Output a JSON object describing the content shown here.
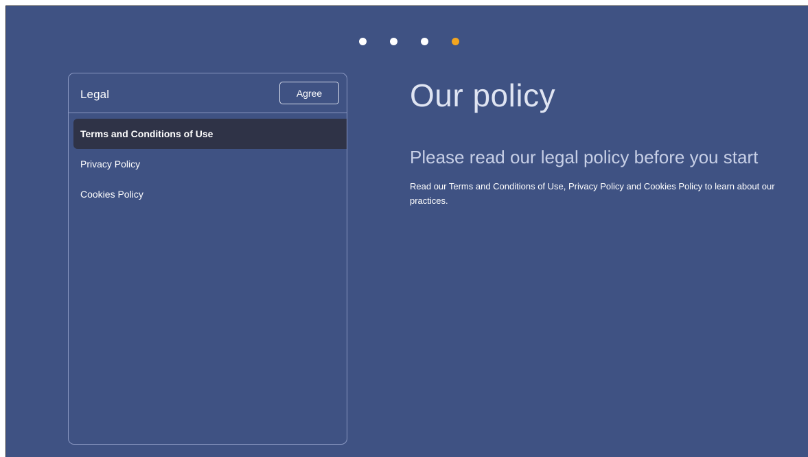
{
  "pager": {
    "dots": [
      {
        "color": "#ffffff",
        "active": false
      },
      {
        "color": "#ffffff",
        "active": false
      },
      {
        "color": "#ffffff",
        "active": false
      },
      {
        "color": "#f3a51f",
        "active": true
      }
    ]
  },
  "legal_panel": {
    "title": "Legal",
    "agree_label": "Agree",
    "items": [
      {
        "label": "Terms and Conditions of Use",
        "selected": true
      },
      {
        "label": "Privacy Policy",
        "selected": false
      },
      {
        "label": "Cookies Policy",
        "selected": false
      }
    ]
  },
  "content": {
    "heading": "Our policy",
    "subheading": "Please read our legal policy before you start",
    "body": "Read our Terms and Conditions of Use, Privacy Policy and Cookies Policy to learn about our practices."
  },
  "colors": {
    "background": "#3f5283",
    "selected_item": "#2f3347",
    "accent": "#f3a51f"
  }
}
